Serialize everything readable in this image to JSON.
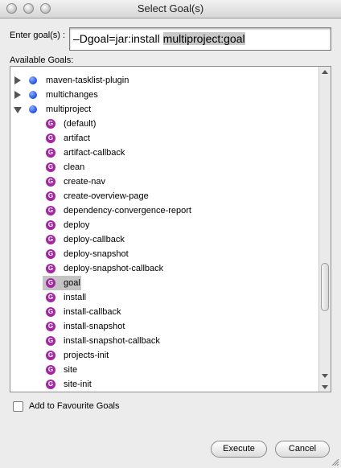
{
  "window": {
    "title": "Select Goal(s)"
  },
  "goal_input": {
    "label": "Enter goal(s) :",
    "prefix": "–Dgoal=jar:install ",
    "selected": "multiproject:goal"
  },
  "available": {
    "label": "Available Goals:"
  },
  "plugins": [
    {
      "label": "maven-tasklist-plugin",
      "state": "collapsed"
    },
    {
      "label": "multichanges",
      "state": "collapsed"
    },
    {
      "label": "multiproject",
      "state": "expanded"
    }
  ],
  "goals": [
    "(default)",
    "artifact",
    "artifact-callback",
    "clean",
    "create-nav",
    "create-overview-page",
    "dependency-convergence-report",
    "deploy",
    "deploy-callback",
    "deploy-snapshot",
    "deploy-snapshot-callback",
    "goal",
    "install",
    "install-callback",
    "install-snapshot",
    "install-snapshot-callback",
    "projects-init",
    "site",
    "site-init"
  ],
  "selected_goal": "goal",
  "goal_icon_glyph": "G",
  "favourite": {
    "label": "Add to Favourite Goals",
    "checked": false
  },
  "buttons": {
    "execute": "Execute",
    "cancel": "Cancel"
  },
  "colors": {
    "plugin_dot": "#1f4fe0",
    "goal_icon": "#a326a3",
    "selection": "#c4c4c4"
  }
}
